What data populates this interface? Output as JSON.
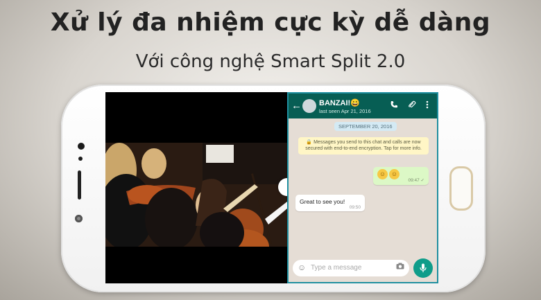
{
  "headline": "Xử lý đa nhiệm cực kỳ dễ dàng",
  "subheadline": "Với công nghệ Smart Split 2.0",
  "chat": {
    "contact_name": "BANZAI!",
    "contact_emoji": "😀",
    "last_seen": "last seen Apr 21, 2016",
    "date_badge": "SEPTEMBER 20, 2016",
    "encryption_notice": "Messages you send to this chat and calls are now secured with end-to-end encryption. Tap for more info.",
    "outgoing": {
      "text": "😊😊",
      "time": "09:47"
    },
    "incoming": {
      "text": "Great to see you!",
      "time": "09:50"
    },
    "input_placeholder": "Type a message"
  },
  "icons": {
    "back": "back-arrow-icon",
    "call": "phone-call-icon",
    "attach": "paperclip-icon",
    "menu": "kebab-menu-icon",
    "emoji": "emoji-icon",
    "camera": "camera-icon",
    "mic": "microphone-icon",
    "lock": "lock-icon"
  },
  "colors": {
    "whatsapp_header": "#075e54",
    "whatsapp_accent": "#0f9d8a",
    "chat_background": "#e5ddd5",
    "outgoing_bubble": "#dcf8c6",
    "phone_body": "#ffffff",
    "home_button_ring": "#d9c9a6"
  }
}
